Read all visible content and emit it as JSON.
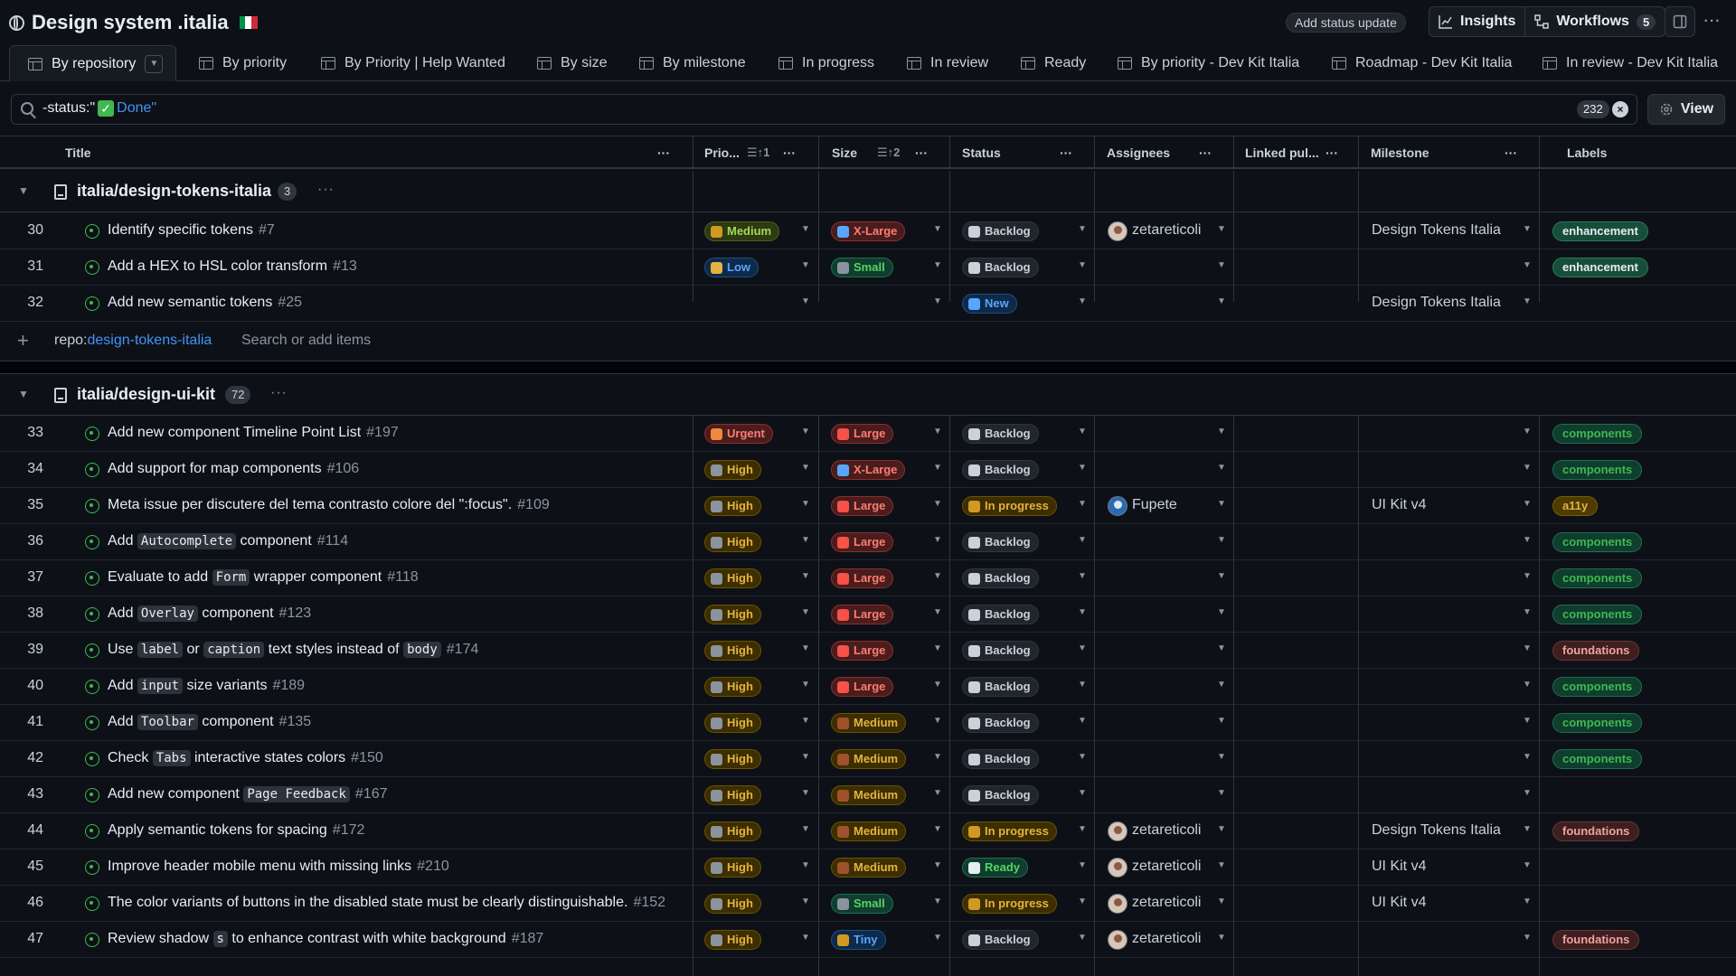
{
  "header": {
    "title": "Design system .italia",
    "status_update": "Add status update",
    "insights": "Insights",
    "workflows": "Workflows",
    "workflows_count": "5"
  },
  "tabs": [
    {
      "label": "By repository"
    },
    {
      "label": "By priority"
    },
    {
      "label": "By Priority | Help Wanted"
    },
    {
      "label": "By size"
    },
    {
      "label": "By milestone"
    },
    {
      "label": "In progress"
    },
    {
      "label": "In review"
    },
    {
      "label": "Ready"
    },
    {
      "label": "By priority - Dev Kit Italia"
    },
    {
      "label": "Roadmap - Dev Kit Italia"
    },
    {
      "label": "In review - Dev Kit Italia"
    }
  ],
  "filter": {
    "prefix": "-status:\"",
    "value": "Done\"",
    "count": "232",
    "view": "View"
  },
  "columns": {
    "title": "Title",
    "priority": "Prio...",
    "priority_sort": "1",
    "size": "Size",
    "size_sort": "2",
    "status": "Status",
    "assignees": "Assignees",
    "linked": "Linked pul...",
    "milestone": "Milestone",
    "labels": "Labels"
  },
  "groups": [
    {
      "name": "italia/design-tokens-italia",
      "count": "3",
      "add_repo_prefix": "repo:",
      "add_repo_name": "design-tokens-italia",
      "add_placeholder": "Search or add items",
      "rows": [
        {
          "n": "30",
          "t": [
            {
              "s": "Identify specific tokens"
            }
          ],
          "num": "#7",
          "prio": "Medium",
          "size": "X-Large",
          "status": "Backlog",
          "assignee": "zetareticoli",
          "milestone": "Design Tokens Italia",
          "label": "enhancement"
        },
        {
          "n": "31",
          "t": [
            {
              "s": "Add a HEX to HSL color transform"
            }
          ],
          "num": "#13",
          "prio": "Low",
          "size": "Small",
          "status": "Backlog",
          "assignee": "",
          "milestone": "",
          "label": "enhancement"
        },
        {
          "n": "32",
          "t": [
            {
              "s": "Add new semantic tokens"
            }
          ],
          "num": "#25",
          "prio": "",
          "size": "",
          "status": "New",
          "assignee": "",
          "milestone": "Design Tokens Italia",
          "label": ""
        }
      ]
    },
    {
      "name": "italia/design-ui-kit",
      "count": "72",
      "rows": [
        {
          "n": "33",
          "t": [
            {
              "s": "Add new component Timeline Point List"
            }
          ],
          "num": "#197",
          "prio": "Urgent",
          "size": "Large",
          "status": "Backlog",
          "assignee": "",
          "milestone": "",
          "label": "components"
        },
        {
          "n": "34",
          "t": [
            {
              "s": "Add support for map components"
            }
          ],
          "num": "#106",
          "prio": "High",
          "size": "X-Large",
          "status": "Backlog",
          "assignee": "",
          "milestone": "",
          "label": "components"
        },
        {
          "n": "35",
          "t": [
            {
              "s": "Meta issue per discutere del tema contrasto colore del \":focus\"."
            }
          ],
          "num": "#109",
          "prio": "High",
          "size": "Large",
          "status": "In progress",
          "assignee": "Fupete",
          "milestone": "UI Kit v4",
          "label": "a11y"
        },
        {
          "n": "36",
          "t": [
            {
              "s": "Add "
            },
            {
              "c": "Autocomplete"
            },
            {
              "s": " component"
            }
          ],
          "num": "#114",
          "prio": "High",
          "size": "Large",
          "status": "Backlog",
          "assignee": "",
          "milestone": "",
          "label": "components"
        },
        {
          "n": "37",
          "t": [
            {
              "s": "Evaluate to add "
            },
            {
              "c": "Form"
            },
            {
              "s": " wrapper component"
            }
          ],
          "num": "#118",
          "prio": "High",
          "size": "Large",
          "status": "Backlog",
          "assignee": "",
          "milestone": "",
          "label": "components"
        },
        {
          "n": "38",
          "t": [
            {
              "s": "Add "
            },
            {
              "c": "Overlay"
            },
            {
              "s": " component"
            }
          ],
          "num": "#123",
          "prio": "High",
          "size": "Large",
          "status": "Backlog",
          "assignee": "",
          "milestone": "",
          "label": "components"
        },
        {
          "n": "39",
          "t": [
            {
              "s": "Use "
            },
            {
              "c": "label"
            },
            {
              "s": " or "
            },
            {
              "c": "caption"
            },
            {
              "s": " text styles instead of "
            },
            {
              "c": "body"
            }
          ],
          "num": "#174",
          "prio": "High",
          "size": "Large",
          "status": "Backlog",
          "assignee": "",
          "milestone": "",
          "label": "foundations"
        },
        {
          "n": "40",
          "t": [
            {
              "s": "Add "
            },
            {
              "c": "input"
            },
            {
              "s": " size variants"
            }
          ],
          "num": "#189",
          "prio": "High",
          "size": "Large",
          "status": "Backlog",
          "assignee": "",
          "milestone": "",
          "label": "components"
        },
        {
          "n": "41",
          "t": [
            {
              "s": "Add "
            },
            {
              "c": "Toolbar"
            },
            {
              "s": " component"
            }
          ],
          "num": "#135",
          "prio": "High",
          "size": "Medium",
          "status": "Backlog",
          "assignee": "",
          "milestone": "",
          "label": "components"
        },
        {
          "n": "42",
          "t": [
            {
              "s": "Check "
            },
            {
              "c": "Tabs"
            },
            {
              "s": " interactive states colors"
            }
          ],
          "num": "#150",
          "prio": "High",
          "size": "Medium",
          "status": "Backlog",
          "assignee": "",
          "milestone": "",
          "label": "components"
        },
        {
          "n": "43",
          "t": [
            {
              "s": "Add new component "
            },
            {
              "c": "Page Feedback"
            }
          ],
          "num": "#167",
          "prio": "High",
          "size": "Medium",
          "status": "Backlog",
          "assignee": "",
          "milestone": "",
          "label": ""
        },
        {
          "n": "44",
          "t": [
            {
              "s": "Apply semantic tokens for spacing"
            }
          ],
          "num": "#172",
          "prio": "High",
          "size": "Medium",
          "status": "In progress",
          "assignee": "zetareticoli",
          "milestone": "Design Tokens Italia",
          "label": "foundations"
        },
        {
          "n": "45",
          "t": [
            {
              "s": "Improve header mobile menu with missing links"
            }
          ],
          "num": "#210",
          "prio": "High",
          "size": "Medium",
          "status": "Ready",
          "assignee": "zetareticoli",
          "milestone": "UI Kit v4",
          "label": ""
        },
        {
          "n": "46",
          "t": [
            {
              "s": "The color variants of buttons in the disabled state must be clearly distinguishable."
            }
          ],
          "num": "#152",
          "prio": "High",
          "size": "Small",
          "status": "In progress",
          "assignee": "zetareticoli",
          "milestone": "UI Kit v4",
          "label": ""
        },
        {
          "n": "47",
          "t": [
            {
              "s": "Review shadow "
            },
            {
              "c": "s"
            },
            {
              "s": " to enhance contrast with white background"
            }
          ],
          "num": "#187",
          "prio": "High",
          "size": "Tiny",
          "status": "Backlog",
          "assignee": "zetareticoli",
          "milestone": "",
          "label": "foundations"
        }
      ]
    }
  ],
  "colors": {
    "accent": "#4493f8",
    "issue_open": "#3fb950",
    "priority": {
      "Urgent": {
        "bg": "#4a1d1d",
        "fg": "#ff7b72",
        "bd": "#8e2c2c",
        "e": "#f0883e"
      },
      "High": {
        "bg": "#3d2e00",
        "fg": "#e3b341",
        "bd": "#6b5200",
        "e": "#8b949e"
      },
      "Medium": {
        "bg": "#2d3a12",
        "fg": "#a5d65a",
        "bd": "#4a6020",
        "e": "#d29922"
      },
      "Low": {
        "bg": "#0d2a4a",
        "fg": "#58a6ff",
        "bd": "#1f4f80",
        "e": "#e3b341"
      }
    },
    "size": {
      "X-Large": {
        "bg": "#4a1d1d",
        "fg": "#ff7b72",
        "bd": "#8e2c2c",
        "e": "#58a6ff"
      },
      "Large": {
        "bg": "#4a1d1d",
        "fg": "#ff7b72",
        "bd": "#8e2c2c",
        "e": "#f85149"
      },
      "Medium": {
        "bg": "#3d2e00",
        "fg": "#e3b341",
        "bd": "#6b5200",
        "e": "#a0522d"
      },
      "Small": {
        "bg": "#0f3d2e",
        "fg": "#56d364",
        "bd": "#1f6f4e",
        "e": "#8b949e"
      },
      "Tiny": {
        "bg": "#0d2a4a",
        "fg": "#58a6ff",
        "bd": "#1f4f80",
        "e": "#d29922"
      }
    },
    "status": {
      "Backlog": {
        "bg": "#21262d",
        "fg": "#c9d1d9",
        "bd": "#30363d",
        "e": "#c9d1d9"
      },
      "New": {
        "bg": "#0d2a4a",
        "fg": "#58a6ff",
        "bd": "#1f4f80",
        "e": "#58a6ff"
      },
      "In progress": {
        "bg": "#3d2e00",
        "fg": "#e3b341",
        "bd": "#6b5200",
        "e": "#d29922"
      },
      "Ready": {
        "bg": "#0f3d2e",
        "fg": "#56d364",
        "bd": "#1f6f4e",
        "e": "#e6edf3"
      }
    }
  }
}
